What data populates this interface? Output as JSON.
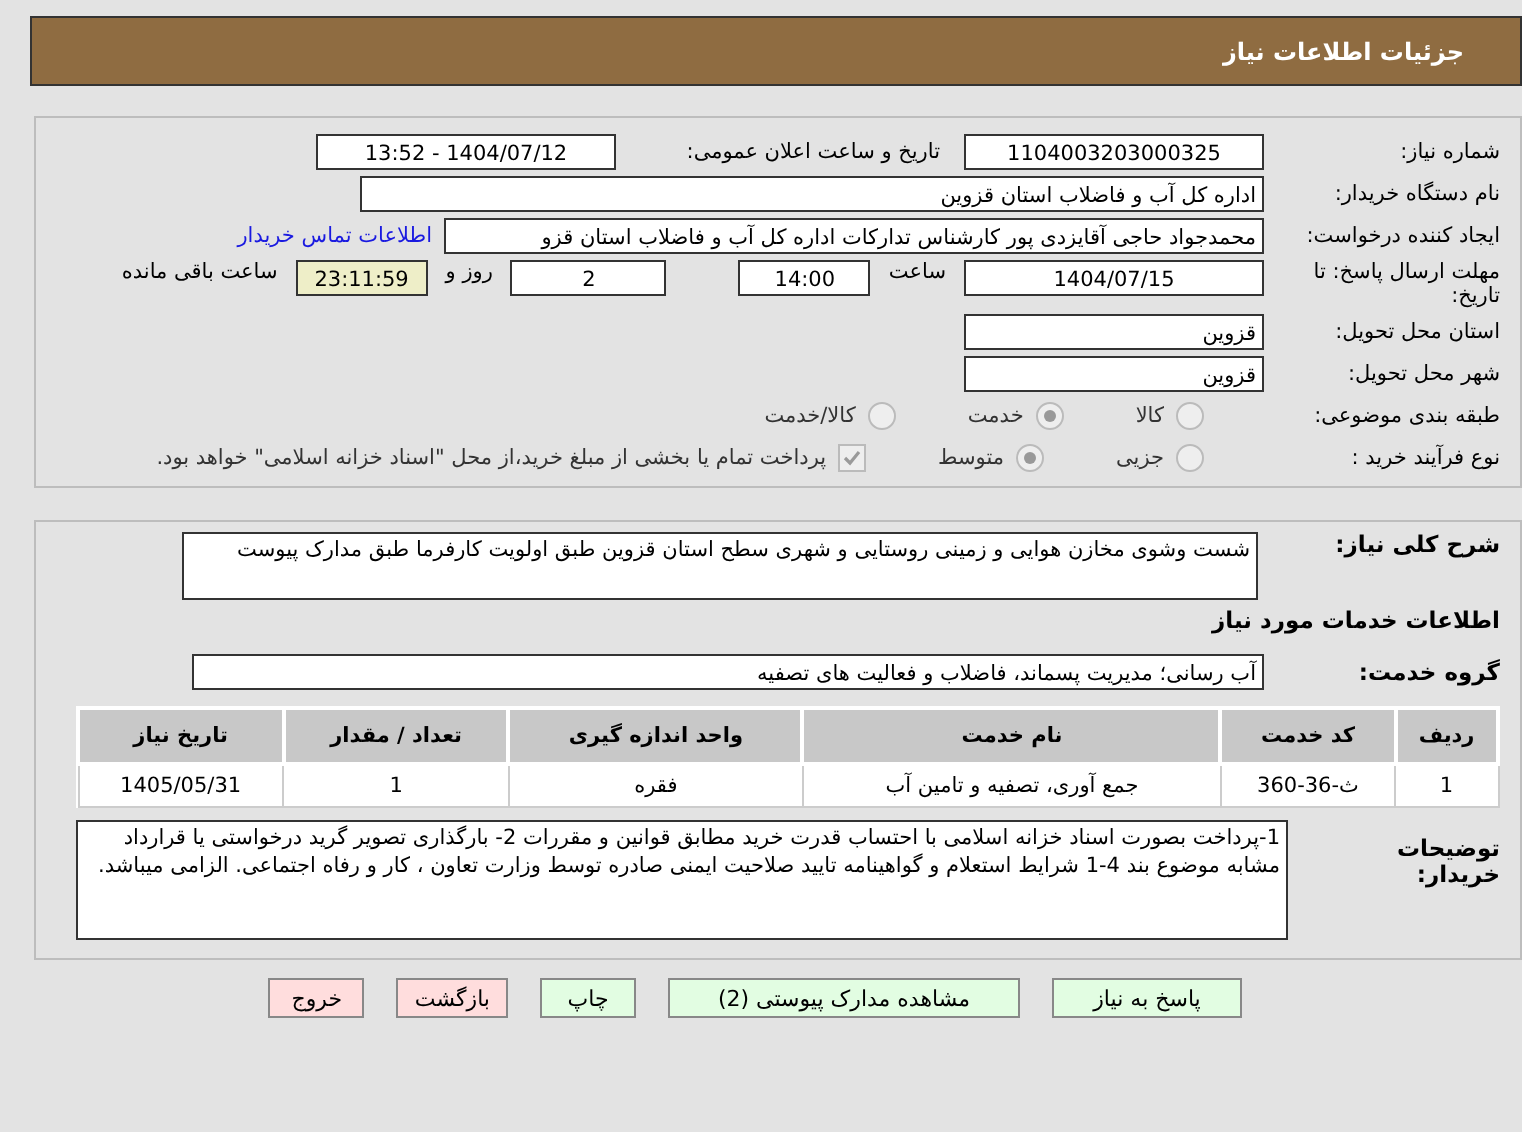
{
  "header": {
    "title": "جزئیات اطلاعات نیاز"
  },
  "need_number": {
    "label": "شماره نیاز:",
    "value": "1104003203000325"
  },
  "announce": {
    "label": "تاریخ و ساعت اعلان عمومی:",
    "value": "1404/07/12 - 13:52"
  },
  "buyer_org": {
    "label": "نام دستگاه خریدار:",
    "value": "اداره کل آب و فاضلاب استان قزوین"
  },
  "creator": {
    "label": "ایجاد کننده درخواست:",
    "value": "محمدجواد حاجی آقایزدی پور کارشناس تدارکات اداره کل آب و فاضلاب استان قزو",
    "link": "اطلاعات تماس خریدار"
  },
  "deadline": {
    "label": "مهلت ارسال پاسخ: تا تاریخ:",
    "date": "1404/07/15",
    "time_label": "ساعت",
    "time": "14:00",
    "days": "2",
    "days_label": "روز و",
    "remaining": "23:11:59",
    "remaining_label": "ساعت باقی مانده"
  },
  "province": {
    "label": "استان محل تحویل:",
    "value": "قزوین"
  },
  "city": {
    "label": "شهر محل تحویل:",
    "value": "قزوین"
  },
  "classification": {
    "label": "طبقه بندی موضوعی:",
    "options": [
      {
        "label": "کالا",
        "selected": false
      },
      {
        "label": "خدمت",
        "selected": true
      },
      {
        "label": "کالا/خدمت",
        "selected": false
      }
    ]
  },
  "process": {
    "label": "نوع فرآیند خرید :",
    "options": [
      {
        "label": "جزیی",
        "selected": false
      },
      {
        "label": "متوسط",
        "selected": true
      }
    ],
    "payment": {
      "checked": true,
      "label": "پرداخت تمام یا بخشی از مبلغ خرید،از محل \"اسناد خزانه اسلامی\" خواهد بود."
    }
  },
  "description": {
    "label": "شرح کلی نیاز:",
    "value": "شست وشوی مخازن هوایی و زمینی روستایی و شهری سطح استان قزوین طبق اولویت کارفرما طبق مدارک پیوست"
  },
  "services_title": "اطلاعات خدمات مورد نیاز",
  "service_group": {
    "label": "گروه خدمت:",
    "value": "آب رسانی؛ مدیریت پسماند، فاضلاب و فعالیت های تصفیه"
  },
  "table": {
    "columns": [
      "ردیف",
      "کد خدمت",
      "نام خدمت",
      "واحد اندازه گیری",
      "تعداد / مقدار",
      "تاریخ نیاز"
    ],
    "rows": [
      [
        "1",
        "ث-36-360",
        "جمع آوری، تصفیه و تامین آب",
        "فقره",
        "1",
        "1405/05/31"
      ]
    ]
  },
  "buyer_notes": {
    "label": "توضیحات خریدار:",
    "value": "1-پرداخت بصورت اسناد خزانه اسلامی با احتساب قدرت خرید مطابق قوانین و مقررات 2- بارگذاری تصویر گرید درخواستی یا قرارداد مشابه موضوع بند 4-1 شرایط استعلام و گواهینامه تایید صلاحیت ایمنی صادره توسط وزارت تعاون ، کار و رفاه اجتماعی. الزامی میباشد."
  },
  "buttons": [
    {
      "label": "پاسخ به نیاز",
      "kind": "primary"
    },
    {
      "label": "مشاهده مدارک پیوستی (2)",
      "kind": "primary"
    },
    {
      "label": "چاپ",
      "kind": "primary"
    },
    {
      "label": "بازگشت",
      "kind": "danger"
    },
    {
      "label": "خروج",
      "kind": "danger"
    }
  ]
}
